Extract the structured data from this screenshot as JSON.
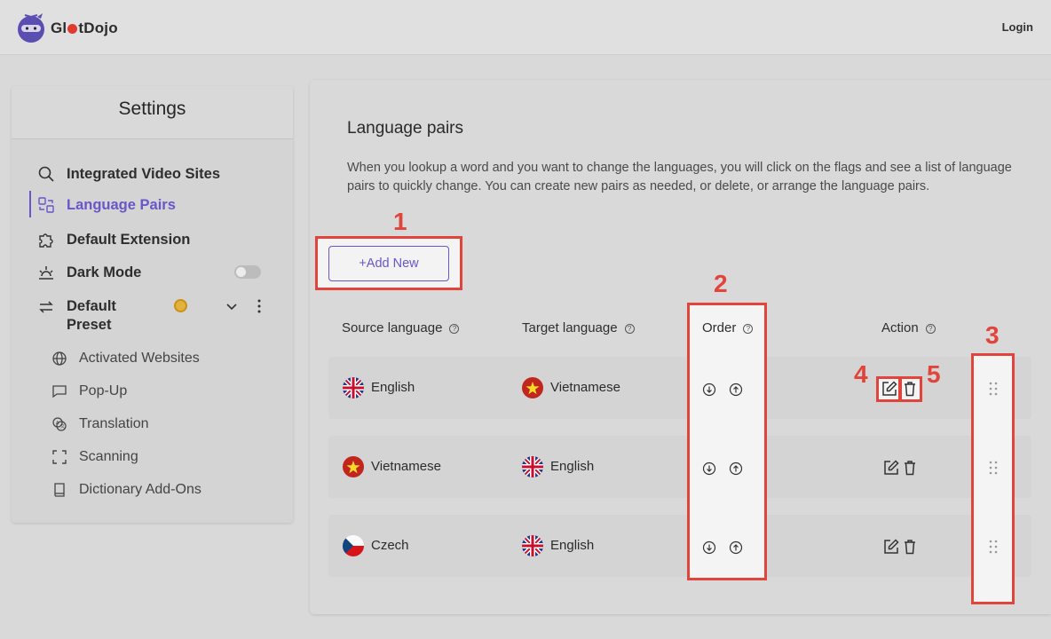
{
  "app": {
    "brand_prefix": "Gl",
    "brand_suffix": "tDojo",
    "login_label": "Login"
  },
  "sidebar": {
    "title": "Settings",
    "items": [
      {
        "label": "Integrated Video Sites",
        "icon": "search-icon"
      },
      {
        "label": "Language Pairs",
        "icon": "language-pairs-icon",
        "active": true
      },
      {
        "label": "Default Extension",
        "icon": "puzzle-icon"
      },
      {
        "label": "Dark Mode",
        "icon": "sunset-icon",
        "toggle": false
      },
      {
        "label": "Default Preset",
        "icon": "swap-icon"
      }
    ],
    "sub_items": [
      {
        "label": "Activated Websites",
        "icon": "globe-icon"
      },
      {
        "label": "Pop-Up",
        "icon": "chat-bubble-icon"
      },
      {
        "label": "Translation",
        "icon": "translate-icon"
      },
      {
        "label": "Scanning",
        "icon": "scan-frame-icon"
      },
      {
        "label": "Dictionary Add-Ons",
        "icon": "book-icon"
      }
    ]
  },
  "main": {
    "title": "Language pairs",
    "description": "When you lookup a word and you want to change the languages, you will click on the flags and see a list of language pairs to quickly change. You can create new pairs as needed, or delete, or arrange the language pairs.",
    "add_button": "+Add New",
    "columns": {
      "source": "Source language",
      "target": "Target language",
      "order": "Order",
      "action": "Action"
    },
    "rows": [
      {
        "source": "English",
        "target": "Vietnamese"
      },
      {
        "source": "Vietnamese",
        "target": "English"
      },
      {
        "source": "Czech",
        "target": "English"
      }
    ]
  },
  "annotations": [
    "1",
    "2",
    "3",
    "4",
    "5"
  ],
  "colors": {
    "accent": "#6a55c9",
    "highlight": "#e0443a"
  }
}
